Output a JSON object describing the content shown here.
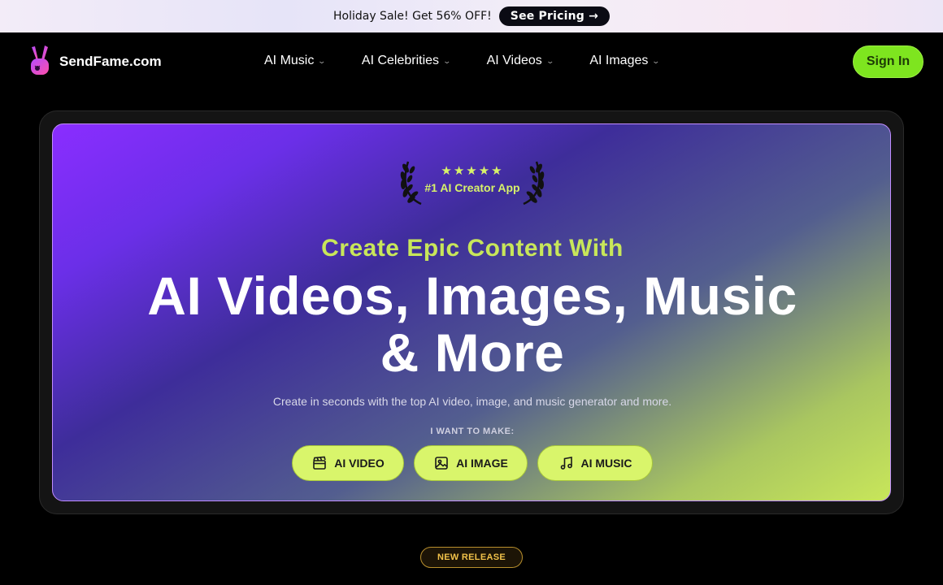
{
  "promo": {
    "text": "Holiday Sale! Get 56% OFF!",
    "button": "See Pricing →"
  },
  "nav": {
    "brand": "SendFame.com",
    "items": [
      {
        "label": "AI Music"
      },
      {
        "label": "AI Celebrities"
      },
      {
        "label": "AI Videos"
      },
      {
        "label": "AI Images"
      }
    ],
    "sign_in": "Sign In"
  },
  "hero": {
    "badge": {
      "stars": "★★★★★",
      "text": "#1 AI Creator App"
    },
    "subtitle": "Create Epic Content With",
    "headline_line1": "AI Videos, Images, Music",
    "headline_line2": "& More",
    "description": "Create in seconds with the top AI video, image, and music generator and more.",
    "want_label": "I WANT TO MAKE:",
    "ctas": [
      {
        "label": "AI VIDEO",
        "icon": "clapperboard-icon"
      },
      {
        "label": "AI IMAGE",
        "icon": "image-icon"
      },
      {
        "label": "AI MUSIC",
        "icon": "music-note-icon"
      }
    ]
  },
  "new_release": "NEW RELEASE",
  "colors": {
    "accent_lime": "#c8e65a",
    "sign_in_green": "#7ee51f",
    "hero_purple": "#8a2dff"
  }
}
